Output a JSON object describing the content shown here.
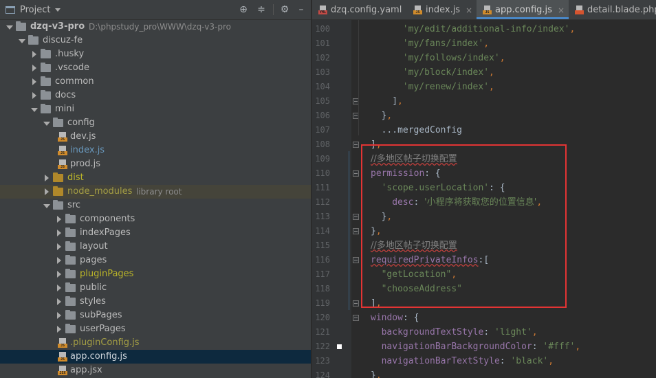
{
  "project_panel": {
    "title": "Project",
    "icons": [
      "crosshair-icon",
      "collapse-all-icon",
      "gear-icon",
      "hide-icon"
    ]
  },
  "tree": [
    {
      "label": "dzq-v3-pro",
      "sub": "D:\\phpstudy_pro\\WWW\\dzq-v3-pro",
      "type": "folder",
      "depth": 0,
      "expanded": true,
      "bold": true
    },
    {
      "label": "discuz-fe",
      "type": "folder",
      "depth": 1,
      "expanded": true
    },
    {
      "label": ".husky",
      "type": "folder",
      "depth": 2,
      "expanded": false
    },
    {
      "label": ".vscode",
      "type": "folder",
      "depth": 2,
      "expanded": false
    },
    {
      "label": "common",
      "type": "folder",
      "depth": 2,
      "expanded": false
    },
    {
      "label": "docs",
      "type": "folder",
      "depth": 2,
      "expanded": false
    },
    {
      "label": "mini",
      "type": "folder",
      "depth": 2,
      "expanded": true
    },
    {
      "label": "config",
      "type": "folder",
      "depth": 3,
      "expanded": true
    },
    {
      "label": "dev.js",
      "type": "js",
      "depth": 4
    },
    {
      "label": "index.js",
      "type": "js",
      "depth": 4,
      "color": "blue"
    },
    {
      "label": "prod.js",
      "type": "js",
      "depth": 4
    },
    {
      "label": "dist",
      "type": "folder-orange",
      "depth": 3,
      "expanded": false,
      "color": "yellow"
    },
    {
      "label": "node_modules",
      "sub": "library root",
      "type": "folder-orange",
      "depth": 3,
      "expanded": false,
      "color": "olive",
      "excluded": true
    },
    {
      "label": "src",
      "type": "folder",
      "depth": 3,
      "expanded": true
    },
    {
      "label": "components",
      "type": "folder",
      "depth": 4,
      "expanded": false
    },
    {
      "label": "indexPages",
      "type": "folder",
      "depth": 4,
      "expanded": false
    },
    {
      "label": "layout",
      "type": "folder",
      "depth": 4,
      "expanded": false
    },
    {
      "label": "pages",
      "type": "folder",
      "depth": 4,
      "expanded": false
    },
    {
      "label": "pluginPages",
      "type": "folder",
      "depth": 4,
      "expanded": false,
      "color": "yellow"
    },
    {
      "label": "public",
      "type": "folder",
      "depth": 4,
      "expanded": false
    },
    {
      "label": "styles",
      "type": "folder",
      "depth": 4,
      "expanded": false
    },
    {
      "label": "subPages",
      "type": "folder",
      "depth": 4,
      "expanded": false
    },
    {
      "label": "userPages",
      "type": "folder",
      "depth": 4,
      "expanded": false
    },
    {
      "label": ".pluginConfig.js",
      "type": "js",
      "depth": 4,
      "color": "olive"
    },
    {
      "label": "app.config.js",
      "type": "js",
      "depth": 4,
      "selected": true
    },
    {
      "label": "app.jsx",
      "type": "jsx",
      "depth": 4
    }
  ],
  "tabs": [
    {
      "label": "dzq.config.yaml",
      "icon": "yaml-file-icon",
      "active": false,
      "closable": false
    },
    {
      "label": "index.js",
      "icon": "js-file-icon",
      "active": false,
      "closable": true
    },
    {
      "label": "app.config.js",
      "icon": "js-file-icon",
      "active": true,
      "closable": true
    },
    {
      "label": "detail.blade.php",
      "icon": "blade-file-icon",
      "active": false,
      "closable": false
    }
  ],
  "code_lines": [
    {
      "n": "100",
      "indent": 6,
      "tokens": [
        [
          "s",
          "'my/edit/additional-info/index'"
        ],
        [
          "p",
          ","
        ]
      ]
    },
    {
      "n": "101",
      "indent": 6,
      "tokens": [
        [
          "s",
          "'my/fans/index'"
        ],
        [
          "p",
          ","
        ]
      ]
    },
    {
      "n": "102",
      "indent": 6,
      "tokens": [
        [
          "s",
          "'my/follows/index'"
        ],
        [
          "p",
          ","
        ]
      ]
    },
    {
      "n": "103",
      "indent": 6,
      "tokens": [
        [
          "s",
          "'my/block/index'"
        ],
        [
          "p",
          ","
        ]
      ]
    },
    {
      "n": "104",
      "indent": 6,
      "tokens": [
        [
          "s",
          "'my/renew/index'"
        ],
        [
          "p",
          ","
        ]
      ]
    },
    {
      "n": "105",
      "indent": 4,
      "tokens": [
        [
          "t",
          "]"
        ],
        [
          "p",
          ","
        ]
      ]
    },
    {
      "n": "106",
      "indent": 2,
      "tokens": [
        [
          "t",
          "}"
        ],
        [
          "p",
          ","
        ]
      ]
    },
    {
      "n": "107",
      "indent": 2,
      "tokens": [
        [
          "t",
          "...mergedConfig"
        ]
      ]
    },
    {
      "n": "108",
      "indent": 0,
      "tokens": [
        [
          "t",
          "]"
        ],
        [
          "p",
          ","
        ]
      ]
    },
    {
      "n": "109",
      "indent": 0,
      "tokens": [
        [
          "c",
          "//多地区帖子切换配置"
        ]
      ]
    },
    {
      "n": "110",
      "indent": 0,
      "tokens": [
        [
          "k",
          "permission"
        ],
        [
          "t",
          ": {"
        ]
      ]
    },
    {
      "n": "111",
      "indent": 2,
      "tokens": [
        [
          "s",
          "'scope.userLocation'"
        ],
        [
          "t",
          ": {"
        ]
      ]
    },
    {
      "n": "112",
      "indent": 4,
      "tokens": [
        [
          "k",
          "desc"
        ],
        [
          "t",
          ": "
        ],
        [
          "s",
          "'小程序将获取您的位置信息'"
        ],
        [
          "p",
          ","
        ]
      ]
    },
    {
      "n": "113",
      "indent": 2,
      "tokens": [
        [
          "t",
          "}"
        ],
        [
          "p",
          ","
        ]
      ]
    },
    {
      "n": "114",
      "indent": 0,
      "tokens": [
        [
          "t",
          "}"
        ],
        [
          "p",
          ","
        ]
      ]
    },
    {
      "n": "115",
      "indent": 0,
      "tokens": [
        [
          "c",
          "//多地区帖子切换配置"
        ]
      ]
    },
    {
      "n": "116",
      "indent": 0,
      "tokens": [
        [
          "k",
          "requiredPrivateInfos"
        ],
        [
          "t",
          ":["
        ]
      ]
    },
    {
      "n": "117",
      "indent": 2,
      "tokens": [
        [
          "s",
          "\"getLocation\""
        ],
        [
          "p",
          ","
        ]
      ]
    },
    {
      "n": "118",
      "indent": 2,
      "tokens": [
        [
          "s",
          "\"chooseAddress\""
        ]
      ]
    },
    {
      "n": "119",
      "indent": 0,
      "tokens": [
        [
          "t",
          "]"
        ],
        [
          "p",
          ","
        ]
      ]
    },
    {
      "n": "120",
      "indent": 0,
      "tokens": [
        [
          "k",
          "window"
        ],
        [
          "t",
          ": {"
        ]
      ]
    },
    {
      "n": "121",
      "indent": 2,
      "tokens": [
        [
          "k",
          "backgroundTextStyle"
        ],
        [
          "t",
          ": "
        ],
        [
          "s",
          "'light'"
        ],
        [
          "p",
          ","
        ]
      ]
    },
    {
      "n": "122",
      "indent": 2,
      "tokens": [
        [
          "k",
          "navigationBarBackgroundColor"
        ],
        [
          "t",
          ": "
        ],
        [
          "s",
          "'#fff'"
        ],
        [
          "p",
          ","
        ]
      ]
    },
    {
      "n": "123",
      "indent": 2,
      "tokens": [
        [
          "k",
          "navigationBarTextStyle"
        ],
        [
          "t",
          ": "
        ],
        [
          "s",
          "'black'"
        ],
        [
          "p",
          ","
        ]
      ]
    },
    {
      "n": "124",
      "indent": 0,
      "tokens": [
        [
          "t",
          "}"
        ],
        [
          "p",
          ","
        ]
      ]
    }
  ],
  "colors": {
    "highlight_box": "#e33434",
    "string": "#6a8759",
    "property": "#9876aa",
    "punctuation": "#cc7832",
    "comment": "#808080"
  }
}
